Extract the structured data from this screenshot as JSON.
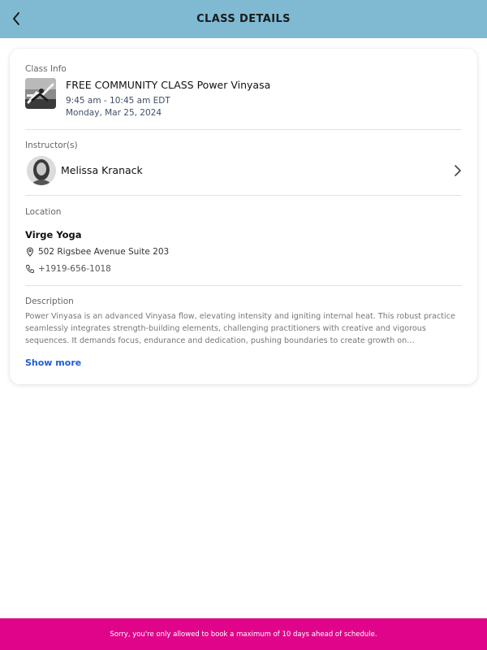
{
  "header": {
    "title": "CLASS DETAILS",
    "background_color": "#7fbad2",
    "back_icon": "chevron-left-icon"
  },
  "class_info": {
    "section_label": "Class Info",
    "name": "FREE COMMUNITY CLASS Power Vinyasa",
    "time": "9:45 am - 10:45 am EDT",
    "date": "Monday, Mar 25, 2024",
    "thumbnail": "yoga-class-photo"
  },
  "instructor": {
    "section_label": "Instructor(s)",
    "name": "Melissa Kranack",
    "chevron_icon": "chevron-right-icon"
  },
  "location": {
    "section_label": "Location",
    "name": "Virge Yoga",
    "address": "502 Rigsbee Avenue Suite 203",
    "address_icon": "map-pin-icon",
    "phone": "+1919-656-1018",
    "phone_icon": "phone-icon"
  },
  "description": {
    "section_label": "Description",
    "text": "Power Vinyasa is an advanced Vinyasa flow, elevating intensity and igniting internal heat.  This robust practice seamlessly integrates strength-building elements, challenging practitioners with creative and vigorous sequences. It demands focus, endurance and dedication, pushing boundaries to create growth on…",
    "show_more_label": "Show more",
    "link_color": "#1f5bd8"
  },
  "toast": {
    "message": "Sorry, you're only allowed to book a maximum of 10 days ahead of schedule.",
    "background_color": "#e0048a"
  }
}
